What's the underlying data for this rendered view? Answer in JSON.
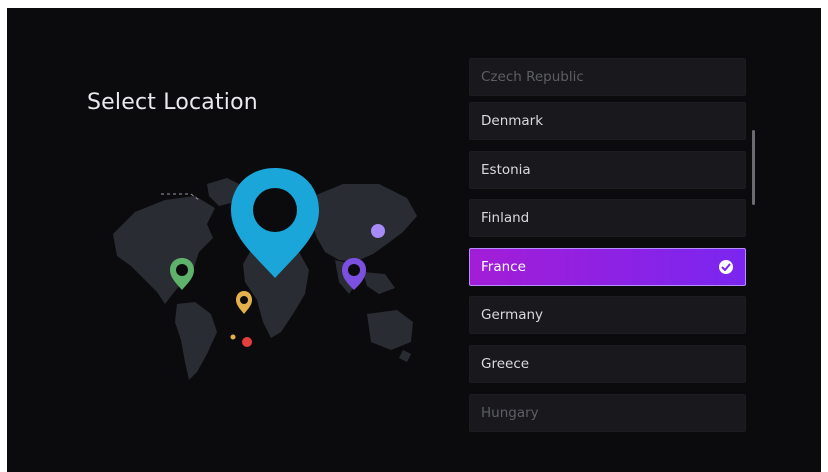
{
  "page": {
    "title": "Select Location"
  },
  "countries": [
    {
      "label": "Czech Republic",
      "state": "faded"
    },
    {
      "label": "Denmark",
      "state": "normal"
    },
    {
      "label": "Estonia",
      "state": "normal"
    },
    {
      "label": "Finland",
      "state": "normal"
    },
    {
      "label": "France",
      "state": "selected"
    },
    {
      "label": "Germany",
      "state": "normal"
    },
    {
      "label": "Greece",
      "state": "normal"
    },
    {
      "label": "Hungary",
      "state": "faded"
    }
  ],
  "colors": {
    "background": "#0b0b0d",
    "item_bg": "#18181d",
    "selected_start": "#a31dd6",
    "selected_end": "#7a26f0",
    "pin_main": "#1aa6d9",
    "pin_green": "#5fb26b",
    "pin_yellow": "#e3b04b",
    "pin_purple": "#7b4fe0"
  },
  "icons": {
    "map": "world-map-icon",
    "selected": "check-circle-icon"
  }
}
